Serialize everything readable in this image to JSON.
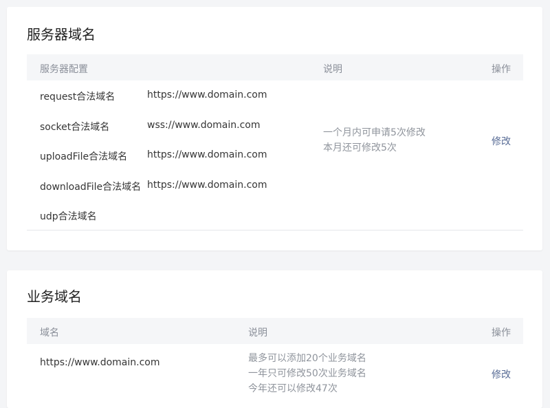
{
  "server_section": {
    "title": "服务器域名",
    "headers": {
      "config": "服务器配置",
      "desc": "说明",
      "action": "操作"
    },
    "rows": [
      {
        "name": "request合法域名",
        "value": "https://www.domain.com"
      },
      {
        "name": "socket合法域名",
        "value": "wss://www.domain.com"
      },
      {
        "name": "uploadFile合法域名",
        "value": "https://www.domain.com"
      },
      {
        "name": "downloadFile合法域名",
        "value": "https://www.domain.com"
      },
      {
        "name": "udp合法域名",
        "value": ""
      }
    ],
    "desc_lines": [
      "一个月内可申请5次修改",
      "本月还可修改5次"
    ],
    "action_label": "修改"
  },
  "business_section": {
    "title": "业务域名",
    "headers": {
      "domain": "域名",
      "desc": "说明",
      "action": "操作"
    },
    "domain": "https://www.domain.com",
    "desc_lines": [
      "最多可以添加20个业务域名",
      "一年只可修改50次业务域名",
      "今年还可以修改47次"
    ],
    "action_label": "修改"
  }
}
